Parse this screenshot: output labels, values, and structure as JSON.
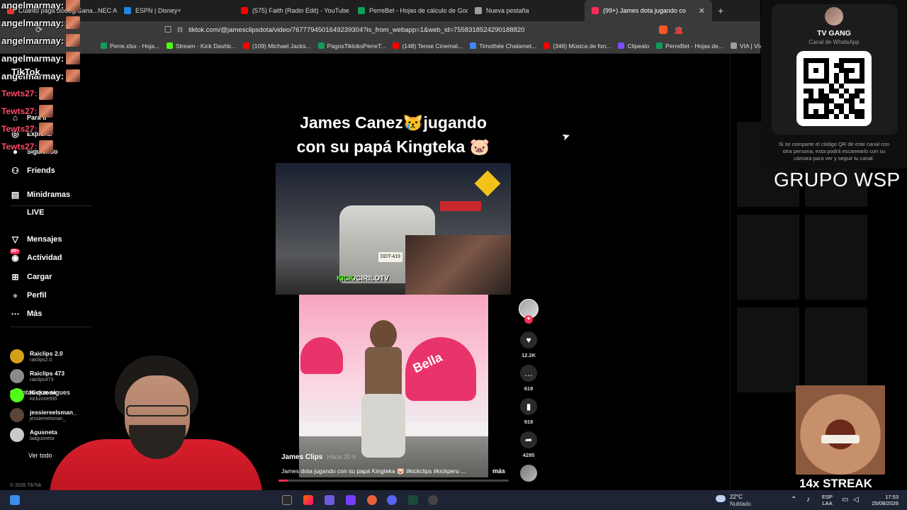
{
  "browser": {
    "tabs": [
      {
        "title": "Cuanto paga Bodog/Gana...NEC Apu",
        "color": "#e53935"
      },
      {
        "title": "ESPN | Disney+",
        "color": "#1e88e5"
      },
      {
        "title": "(575) Faith (Radio Edit) - YouTube",
        "color": "#ff0000"
      },
      {
        "title": "PerreBet - Hojas de cálculo de Google",
        "color": "#0f9d58"
      },
      {
        "title": "Nueva pestaña",
        "color": "#9e9e9e"
      },
      {
        "title": "(99+) James dota jugando co",
        "color": "#fe2c55"
      }
    ],
    "url": "tiktok.com/@jamesclipsdota/video/7677794501649239304?is_from_webapp=1&web_id=7558318524290188820",
    "bookmarks": [
      {
        "label": "Perre.xlsx - Hoja...",
        "color": "#0f9d58"
      },
      {
        "label": "Stream - Kick Dashb...",
        "color": "#53fc18"
      },
      {
        "label": "(109) Michael Jacks...",
        "color": "#ff0000"
      },
      {
        "label": "PagosTiktoksPerreT...",
        "color": "#0f9d58"
      },
      {
        "label": "(148) Tense Cinemat...",
        "color": "#ff0000"
      },
      {
        "label": "Timothée Chalamet...",
        "color": "#4285f4"
      },
      {
        "label": "(346) Música de fon...",
        "color": "#ff0000"
      },
      {
        "label": "Clipealo",
        "color": "#7c4dff"
      },
      {
        "label": "PerreBet - Hojas de...",
        "color": "#0f9d58"
      },
      {
        "label": "VIA | VIA",
        "color": "#9e9e9e"
      },
      {
        "label": "Copia de Perre .xlsx...",
        "color": "#0f9d58"
      }
    ]
  },
  "chat": [
    {
      "name": "angelmarmay:",
      "kind": "a"
    },
    {
      "name": "angelmarmay:",
      "kind": "a"
    },
    {
      "name": "angelmarmay:",
      "kind": "a"
    },
    {
      "name": "angelmarmay:",
      "kind": "a"
    },
    {
      "name": "angelmarmay:",
      "kind": "a"
    },
    {
      "name": "Tewts27:",
      "kind": "t"
    },
    {
      "name": "Tewts27:",
      "kind": "t"
    },
    {
      "name": "Tewts27:",
      "kind": "t"
    },
    {
      "name": "Tewts27:",
      "kind": "t"
    }
  ],
  "sidebar": {
    "logo": "TikTok",
    "items_partial": [
      "Para ti",
      "Explorar",
      "Siguiendo"
    ],
    "items": [
      {
        "label": "Friends",
        "icon": "friends-icon"
      },
      {
        "label": "Minidramas",
        "icon": "minidramas-icon"
      },
      {
        "label": "LIVE",
        "icon": "live-icon"
      },
      {
        "label": "Mensajes",
        "icon": "messages-icon"
      },
      {
        "label": "Actividad",
        "icon": "activity-icon",
        "badge": "99+"
      },
      {
        "label": "Cargar",
        "icon": "upload-icon"
      },
      {
        "label": "Perfil",
        "icon": "profile-icon"
      },
      {
        "label": "Más",
        "icon": "more-icon"
      }
    ],
    "following_heading": "Cuentas que sigues",
    "following": [
      {
        "name": "Raiclips 2.0",
        "handle": "raiclips2.0",
        "color": "#d4a017"
      },
      {
        "name": "Raiclips 473",
        "handle": "raiclips473",
        "color": "#8a8a8a"
      },
      {
        "name": "Kickzone",
        "handle": "kickzone995",
        "color": "#53fc18"
      },
      {
        "name": "jessiereelsman_",
        "handle": "jessiereelsman_",
        "color": "#5a4638"
      },
      {
        "name": "Agusneta",
        "handle": "laagusneta",
        "color": "#c9c9c9"
      }
    ],
    "see_all": "Ver todo",
    "copyright": "© 2026 TikTok"
  },
  "video": {
    "title_line1": "James Canez😿jugando",
    "title_line2": "con su papá Kingteka 🐷",
    "clip_watermark_prefix": "KICK",
    "clip_watermark_rest": "/CIRILOTV",
    "plate": "DDT-419",
    "heart_word": "Bella",
    "channel": "James Clips",
    "posted": "Hace 20 h",
    "description": "James dota jugando con su papá Kingteka 🐷 #kickclips #kickperu ...",
    "more": "más",
    "progress": 0.04
  },
  "actions": {
    "likes": "12.2K",
    "comments": "618",
    "saves": "918",
    "shares": "4295"
  },
  "whatsapp": {
    "name": "TV GANG",
    "subtitle": "Canal de WhatsApp",
    "note": "Si se comparte el código QR de este canal con otra persona, esta podrá escanearlo con su cámara para ver y seguir tu canal."
  },
  "overlay": {
    "grupo": "GRUPO WSP",
    "streak": "14x STREAK"
  },
  "taskbar": {
    "temp": "22°C",
    "weather": "Nublado",
    "lang1": "ESP",
    "lang2": "LAA",
    "time": "17:53",
    "date": "25/08/2026"
  }
}
